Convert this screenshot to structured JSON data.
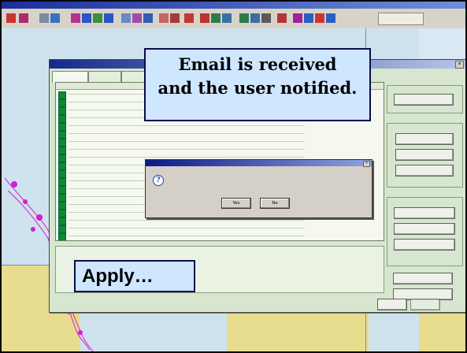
{
  "callout": {
    "line1": "Email is received",
    "line2": "and the user notified."
  },
  "apply_callout": {
    "text": "Apply…"
  },
  "alert": {
    "buttons": [
      "Yes",
      "No"
    ]
  },
  "icons": [
    "question-icon",
    "chart-square-icon",
    "close-icon"
  ],
  "colors": {
    "callout_bg": "#cfe6ff",
    "list_status": "#0d8a2a",
    "route_magenta": "#d020d0",
    "land": "#e8dc8e",
    "sea": "#cfe3ee"
  }
}
